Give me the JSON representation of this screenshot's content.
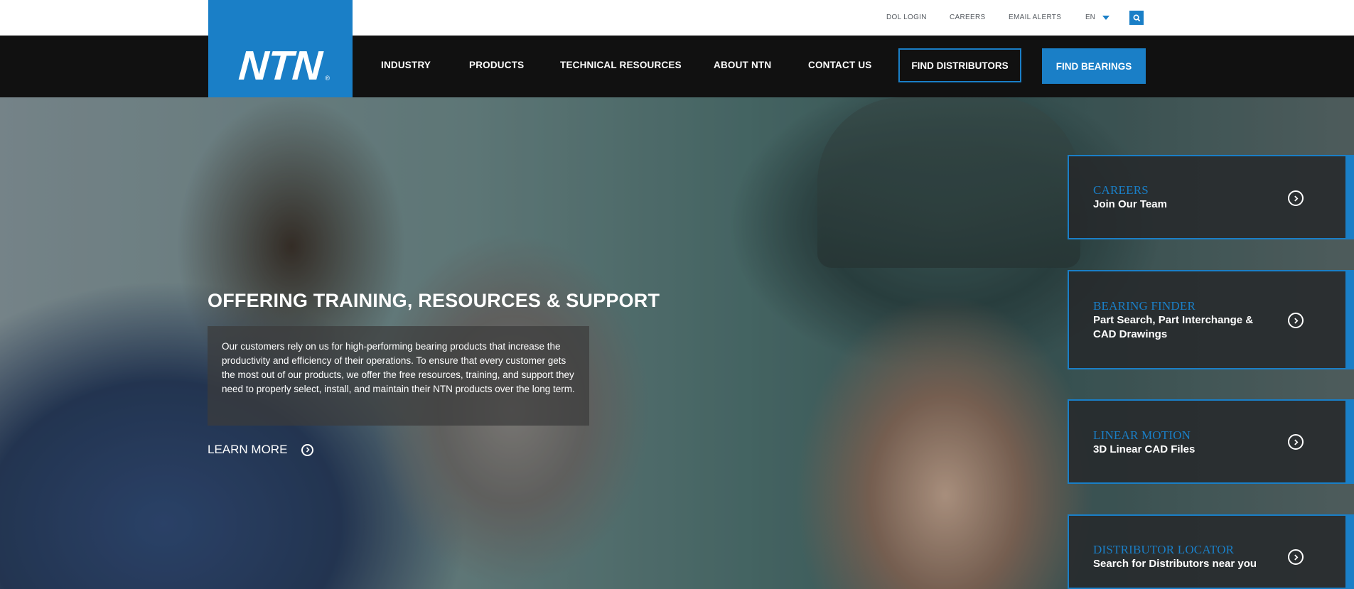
{
  "utility_bar": {
    "links": [
      "DOL LOGIN",
      "CAREERS",
      "EMAIL ALERTS"
    ],
    "language": "EN"
  },
  "brand": {
    "logo_text": "NTN",
    "registered": "®"
  },
  "nav": {
    "items": [
      "INDUSTRY",
      "PRODUCTS",
      "TECHNICAL RESOURCES",
      "ABOUT NTN",
      "CONTACT US"
    ],
    "find_distributors": "FIND DISTRIBUTORS",
    "find_bearings": "FIND BEARINGS"
  },
  "hero": {
    "headline": "OFFERING TRAINING, RESOURCES & SUPPORT",
    "description": "Our customers rely on us for high-performing bearing products that increase the productivity and efficiency of their operations. To ensure that every customer gets the most out of our products, we offer the free resources, training, and support they need to properly select, install, and maintain their NTN products over the long term.",
    "cta": "LEARN MORE"
  },
  "cards": [
    {
      "title": "CAREERS",
      "subtitle": "Join Our Team"
    },
    {
      "title": "BEARING FINDER",
      "subtitle": "Part Search, Part Interchange & CAD Drawings"
    },
    {
      "title": "LINEAR MOTION",
      "subtitle": "3D Linear CAD Files"
    },
    {
      "title": "DISTRIBUTOR LOCATOR",
      "subtitle": "Search for Distributors near you"
    }
  ],
  "colors": {
    "accent": "#1a7fc7",
    "nav_bg": "#111111"
  }
}
